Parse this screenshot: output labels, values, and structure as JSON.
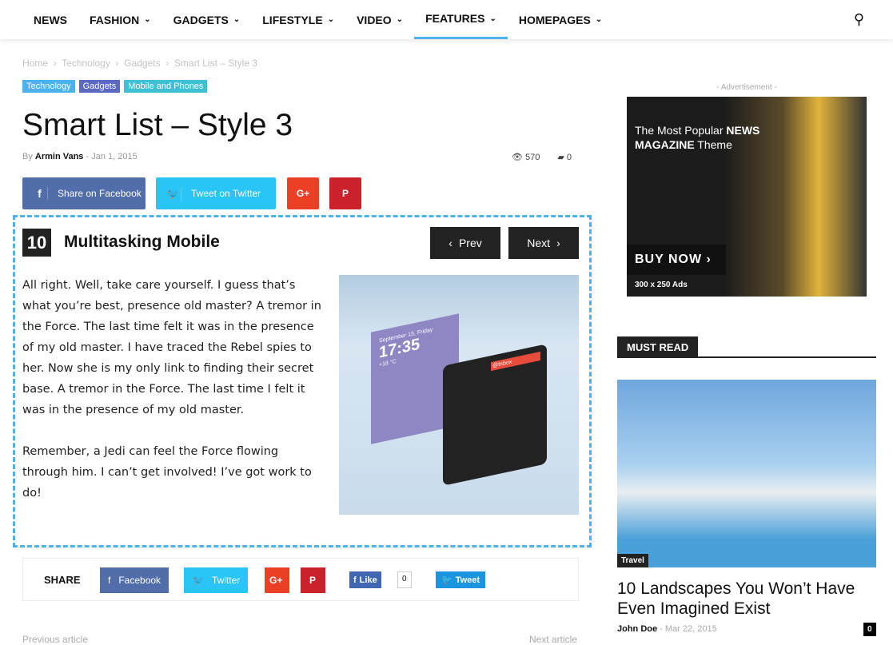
{
  "nav": {
    "items": [
      "NEWS",
      "FASHION",
      "GADGETS",
      "LIFESTYLE",
      "VIDEO",
      "FEATURES",
      "HOMEPAGES"
    ],
    "active": "FEATURES"
  },
  "breadcrumb": [
    "Home",
    "Technology",
    "Gadgets",
    "Smart List – Style 3"
  ],
  "tags": [
    {
      "label": "Technology",
      "color": "#4db2ec"
    },
    {
      "label": "Gadgets",
      "color": "#5c69c1"
    },
    {
      "label": "Mobile and Phones",
      "color": "#40c0d8"
    }
  ],
  "title": "Smart List – Style 3",
  "meta": {
    "by": "By",
    "author": "Armin Vans",
    "date": "Jan 1, 2015",
    "views": "570",
    "comments": "0"
  },
  "share_top": {
    "facebook": "Share on Facebook",
    "twitter": "Tweet on Twitter"
  },
  "item": {
    "number": "10",
    "title": "Multitasking Mobile",
    "prev": "Prev",
    "next": "Next",
    "paragraphs": [
      "All right. Well, take care yourself. I guess that’s what you’re best, presence old master? A tremor in the Force. The last time felt it was in the presence of my old master. I have traced the Rebel spies to her. Now she is my only link to finding their secret base. A tremor in the Force. The last time I felt it was in the presence of my old master.",
      "Remember, a Jedi can feel the Force flowing through him. I can’t get involved! I’ve got work to do!"
    ],
    "phone": {
      "time": "17:35",
      "date": "September 15, Friday",
      "temp": "+18 °C",
      "inbox": "@Inbox"
    }
  },
  "share_bottom": {
    "label": "SHARE",
    "facebook": "Facebook",
    "twitter": "Twitter",
    "like": "Like",
    "like_count": "0",
    "tweet": "Tweet"
  },
  "footer_nav": {
    "prev": "Previous article",
    "next": "Next article"
  },
  "ad": {
    "label": "- Advertisement -",
    "line1": "The Most Popular ",
    "line1b": "NEWS",
    "line2b": "MAGAZINE",
    "line2": " Theme",
    "cta": "BUY NOW",
    "size": "300 x 250 Ads"
  },
  "must_read": {
    "heading": "MUST READ",
    "category": "Travel",
    "title": "10 Landscapes You Won’t Have Even Imagined Exist",
    "author": "John Doe",
    "date": "Mar 22, 2015",
    "comments": "0"
  }
}
